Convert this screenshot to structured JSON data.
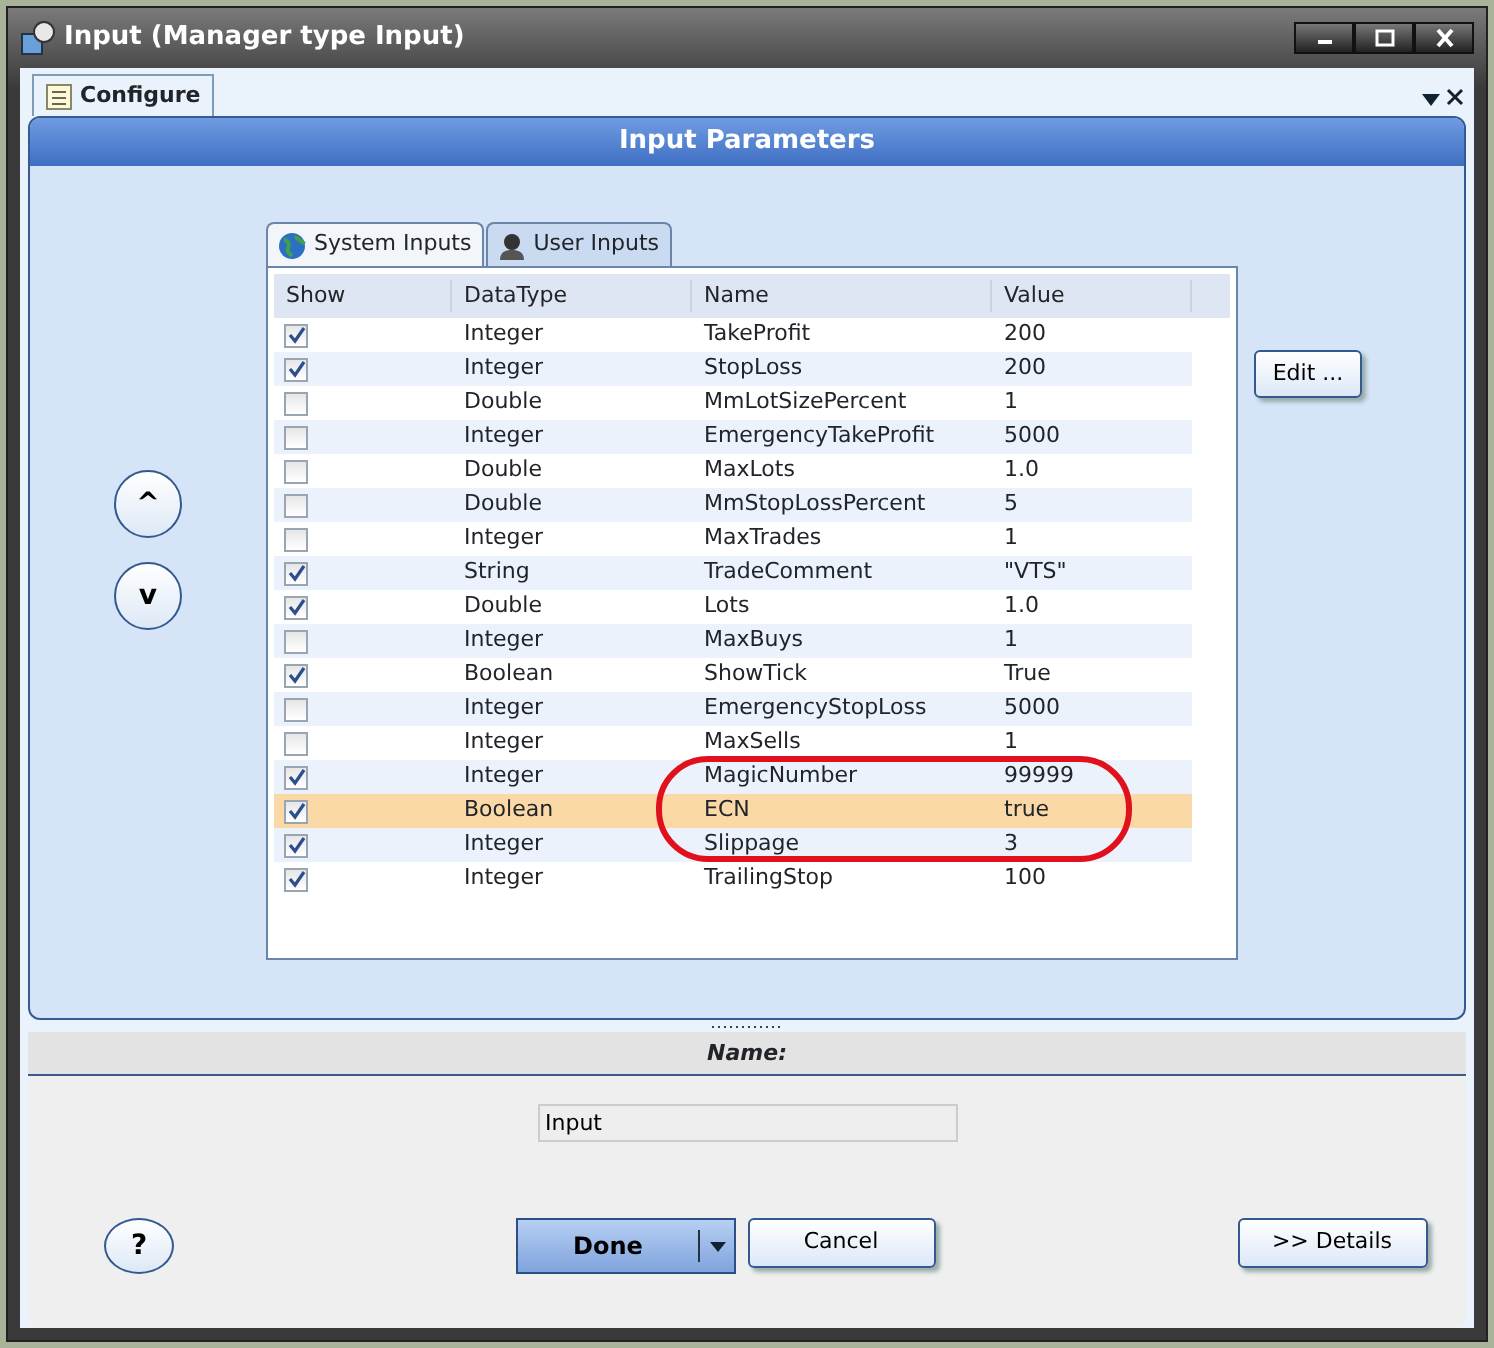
{
  "window": {
    "title": "Input (Manager type Input)"
  },
  "doc_tabs": [
    {
      "label": "Configure",
      "selected": true
    }
  ],
  "panel": {
    "title": "Input Parameters"
  },
  "input_tabs": [
    {
      "label": "System Inputs",
      "selected": true
    },
    {
      "label": "User Inputs",
      "selected": false
    }
  ],
  "table": {
    "columns": [
      "Show",
      "DataType",
      "Name",
      "Value"
    ],
    "rows": [
      {
        "checked": true,
        "type": "Integer",
        "name": "TakeProfit",
        "value": "200",
        "selected": false
      },
      {
        "checked": true,
        "type": "Integer",
        "name": "StopLoss",
        "value": "200",
        "selected": false
      },
      {
        "checked": false,
        "type": "Double",
        "name": "MmLotSizePercent",
        "value": "1",
        "selected": false
      },
      {
        "checked": false,
        "type": "Integer",
        "name": "EmergencyTakeProfit",
        "value": "5000",
        "selected": false
      },
      {
        "checked": false,
        "type": "Double",
        "name": "MaxLots",
        "value": "1.0",
        "selected": false
      },
      {
        "checked": false,
        "type": "Double",
        "name": "MmStopLossPercent",
        "value": "5",
        "selected": false
      },
      {
        "checked": false,
        "type": "Integer",
        "name": "MaxTrades",
        "value": "1",
        "selected": false
      },
      {
        "checked": true,
        "type": "String",
        "name": "TradeComment",
        "value": "\"VTS\"",
        "selected": false
      },
      {
        "checked": true,
        "type": "Double",
        "name": "Lots",
        "value": "1.0",
        "selected": false
      },
      {
        "checked": false,
        "type": "Integer",
        "name": "MaxBuys",
        "value": "1",
        "selected": false
      },
      {
        "checked": true,
        "type": "Boolean",
        "name": "ShowTick",
        "value": "True",
        "selected": false
      },
      {
        "checked": false,
        "type": "Integer",
        "name": "EmergencyStopLoss",
        "value": "5000",
        "selected": false
      },
      {
        "checked": false,
        "type": "Integer",
        "name": "MaxSells",
        "value": "1",
        "selected": false
      },
      {
        "checked": true,
        "type": "Integer",
        "name": "MagicNumber",
        "value": "99999",
        "selected": false
      },
      {
        "checked": true,
        "type": "Boolean",
        "name": "ECN",
        "value": "true",
        "selected": true
      },
      {
        "checked": true,
        "type": "Integer",
        "name": "Slippage",
        "value": "3",
        "selected": false
      },
      {
        "checked": true,
        "type": "Integer",
        "name": "TrailingStop",
        "value": "100",
        "selected": false
      }
    ]
  },
  "move_buttons": [
    "^",
    "v"
  ],
  "edit_button": "Edit ...",
  "name_section": {
    "title": "Name:",
    "value": "Input"
  },
  "buttons": {
    "help": "?",
    "done": "Done",
    "cancel": "Cancel",
    "details": ">> Details"
  }
}
